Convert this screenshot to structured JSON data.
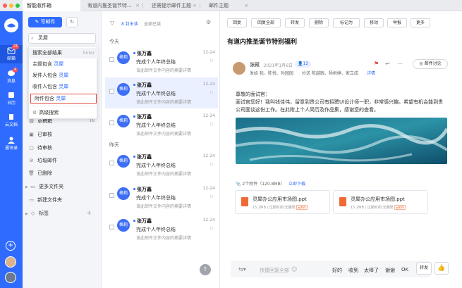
{
  "tabs": [
    {
      "label": "智能收件箱"
    },
    {
      "label": "有道内推圣诞节特..."
    },
    {
      "label": "还需提示邮件主题"
    },
    {
      "label": "邮件主题"
    }
  ],
  "rail": {
    "items": [
      {
        "label": "邮箱",
        "badge": "21"
      },
      {
        "label": "消息",
        "badge": "4"
      },
      {
        "label": "日历"
      },
      {
        "label": "云文档"
      },
      {
        "label": "通讯录"
      }
    ]
  },
  "folders": {
    "write_label": "写邮件",
    "search_value": "灵犀",
    "items": [
      {
        "label": "草稿箱",
        "count": "16"
      },
      {
        "label": "已审核"
      },
      {
        "label": "待审核"
      },
      {
        "label": "垃圾邮件"
      },
      {
        "label": "已删除"
      },
      {
        "label": "更多文件夹"
      },
      {
        "label": "新建文件夹"
      },
      {
        "label": "标签"
      }
    ]
  },
  "search_dropdown": {
    "all_results": "搜索全部结果",
    "enter_hint": "Enter",
    "keyword": "灵犀",
    "rows": [
      {
        "prefix": "主题包含"
      },
      {
        "prefix": "发件人包含"
      },
      {
        "prefix": "收件人包含"
      },
      {
        "prefix": "附件包含"
      }
    ],
    "advanced": "高级搜索"
  },
  "list_header": {
    "count_label": "8 封未读",
    "mark_all": "全部已读"
  },
  "groups": {
    "today": "今天",
    "yesterday": "昨天"
  },
  "mails": [
    {
      "avatar": "格莉",
      "name": "张万鑫",
      "subject": "完成个人年终总结",
      "snippet": "该此邮件文件内容的摘要详情",
      "date": "12-24"
    },
    {
      "avatar": "格莉",
      "name": "张万鑫",
      "subject": "完成个人年终总结",
      "snippet": "该此邮件文件内容的摘要详情",
      "date": "12-24"
    },
    {
      "avatar": "格莉",
      "name": "张万鑫",
      "subject": "完成个人年终总结",
      "snippet": "该此邮件文件内容的摘要详情",
      "date": "12-24"
    },
    {
      "avatar": "格莉",
      "name": "张万鑫",
      "subject": "完成个人年终总结",
      "snippet": "该此邮件文件内容的摘要详情",
      "date": "12-24"
    },
    {
      "avatar": "格莉",
      "name": "张万鑫",
      "subject": "完成个人年终总结",
      "snippet": "该此邮件文件内容的摘要详情",
      "date": "12-24"
    },
    {
      "avatar": "格莉",
      "name": "张万鑫",
      "subject": "完成个人年终总结",
      "snippet": "该此邮件文件内容的摘要详情",
      "date": "12-24"
    }
  ],
  "toolbar": [
    "回复",
    "回复全部",
    "转发",
    "删除",
    "标记为",
    "移动",
    "举报",
    "更多"
  ],
  "reader": {
    "title": "有道内推圣诞节特别福利",
    "sender": "张殿",
    "date": "2021年1月6日",
    "recipient_count": "12",
    "to_line": "发给 我、陈悦、孙园园",
    "cc_line": "抄送 陈越践、杨树婷、家立成",
    "detail": "详情",
    "discuss": "邮件讨论",
    "greeting": "尊敬的面试官：",
    "body": "面试官您好！我叫钱佳伟，留意到贵公司有招聘UI设计师一职，非常感兴趣。希望有机会能到贵公司面谈这份工作。在此附上个人简历及作品集，感谢您的查看。",
    "attach_summary": "2个附件（120.8MB）",
    "download_all": "立即下载",
    "attachments": [
      {
        "name": "灵犀办公应用市场图.ppt",
        "meta": "15.2MB | 过期时间:无期限",
        "tag": "云附件"
      },
      {
        "name": "灵犀办公应用市场图.ppt",
        "meta": "15.2MB | 过期时间:无期限",
        "tag": "云附件"
      }
    ]
  },
  "reply_bar": {
    "placeholder": "快捷回复全部",
    "quick": [
      "好的",
      "收到",
      "太棒了",
      "谢谢",
      "OK"
    ],
    "forward": "转发"
  },
  "colors": {
    "accent": "#2f6bff",
    "badge": "#ff4d4f"
  }
}
